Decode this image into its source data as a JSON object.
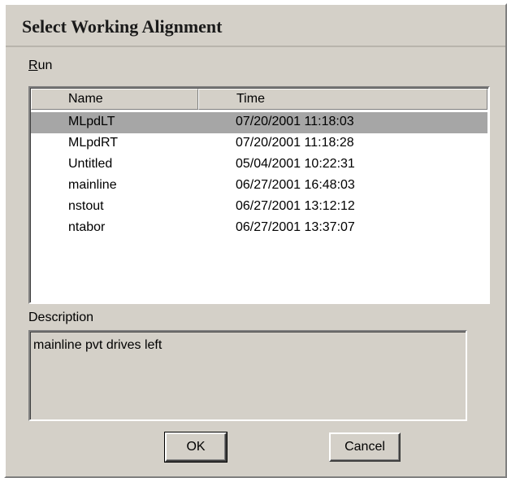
{
  "window": {
    "title": "Select Working Alignment"
  },
  "menu": {
    "run_label_accel": "R",
    "run_label_rest": "un"
  },
  "list": {
    "columns": {
      "name": "Name",
      "time": "Time"
    },
    "selected_index": 0,
    "rows": [
      {
        "name": "MLpdLT",
        "time": "07/20/2001 11:18:03"
      },
      {
        "name": "MLpdRT",
        "time": "07/20/2001 11:18:28"
      },
      {
        "name": "Untitled",
        "time": "05/04/2001 10:22:31"
      },
      {
        "name": "mainline",
        "time": "06/27/2001 16:48:03"
      },
      {
        "name": "nstout",
        "time": "06/27/2001 13:12:12"
      },
      {
        "name": "ntabor",
        "time": "06/27/2001 13:37:07"
      }
    ]
  },
  "description": {
    "label": "Description",
    "text": "mainline pvt drives left"
  },
  "buttons": {
    "ok": "OK",
    "cancel": "Cancel"
  },
  "colors": {
    "dialog_bg": "#d4d0c8",
    "selection_bg": "#a6a6a6"
  }
}
